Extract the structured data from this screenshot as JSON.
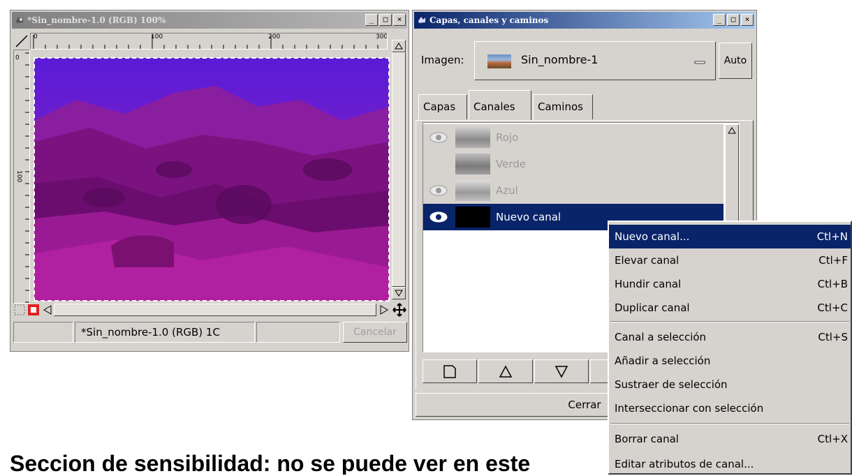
{
  "image_window": {
    "title": "*Sin_nombre-1.0 (RGB) 100%",
    "ruler_h_labels": [
      "0",
      "100",
      "200",
      "300"
    ],
    "ruler_v_labels": [
      "0",
      "100"
    ],
    "status_title": "*Sin_nombre-1.0 (RGB) 1C",
    "cancel_label": "Cancelar"
  },
  "layers_dialog": {
    "title": "Capas, canales y caminos",
    "image_label": "Imagen:",
    "image_name": "Sin_nombre-1",
    "auto_label": "Auto",
    "tabs": [
      "Capas",
      "Canales",
      "Caminos"
    ],
    "channels": [
      {
        "name": "Rojo",
        "visible": true
      },
      {
        "name": "Verde",
        "visible": false
      },
      {
        "name": "Azul",
        "visible": true
      },
      {
        "name": "Nuevo canal",
        "visible": true,
        "selected": true
      }
    ],
    "close_label": "Cerrar"
  },
  "context_menu": {
    "items": [
      {
        "label": "Nuevo canal...",
        "shortcut": "Ctl+N"
      },
      {
        "label": "Elevar canal",
        "shortcut": "Ctl+F"
      },
      {
        "label": "Hundir canal",
        "shortcut": "Ctl+B"
      },
      {
        "label": "Duplicar canal",
        "shortcut": "Ctl+C"
      },
      {
        "label": "Canal a selección",
        "shortcut": "Ctl+S"
      },
      {
        "label": "Añadir a selección",
        "shortcut": ""
      },
      {
        "label": "Sustraer de selección",
        "shortcut": ""
      },
      {
        "label": "Interseccionar con selección",
        "shortcut": ""
      },
      {
        "label": "Borrar canal",
        "shortcut": "Ctl+X"
      },
      {
        "label": "Editar atributos de canal...",
        "shortcut": ""
      }
    ]
  },
  "caption": "Seccion de sensibilidad: no se puede ver en este",
  "colors": {
    "titlebar_active": "#0a246a",
    "titlebar_inactive": "#808080",
    "image_tint": "#9b1a9b"
  }
}
